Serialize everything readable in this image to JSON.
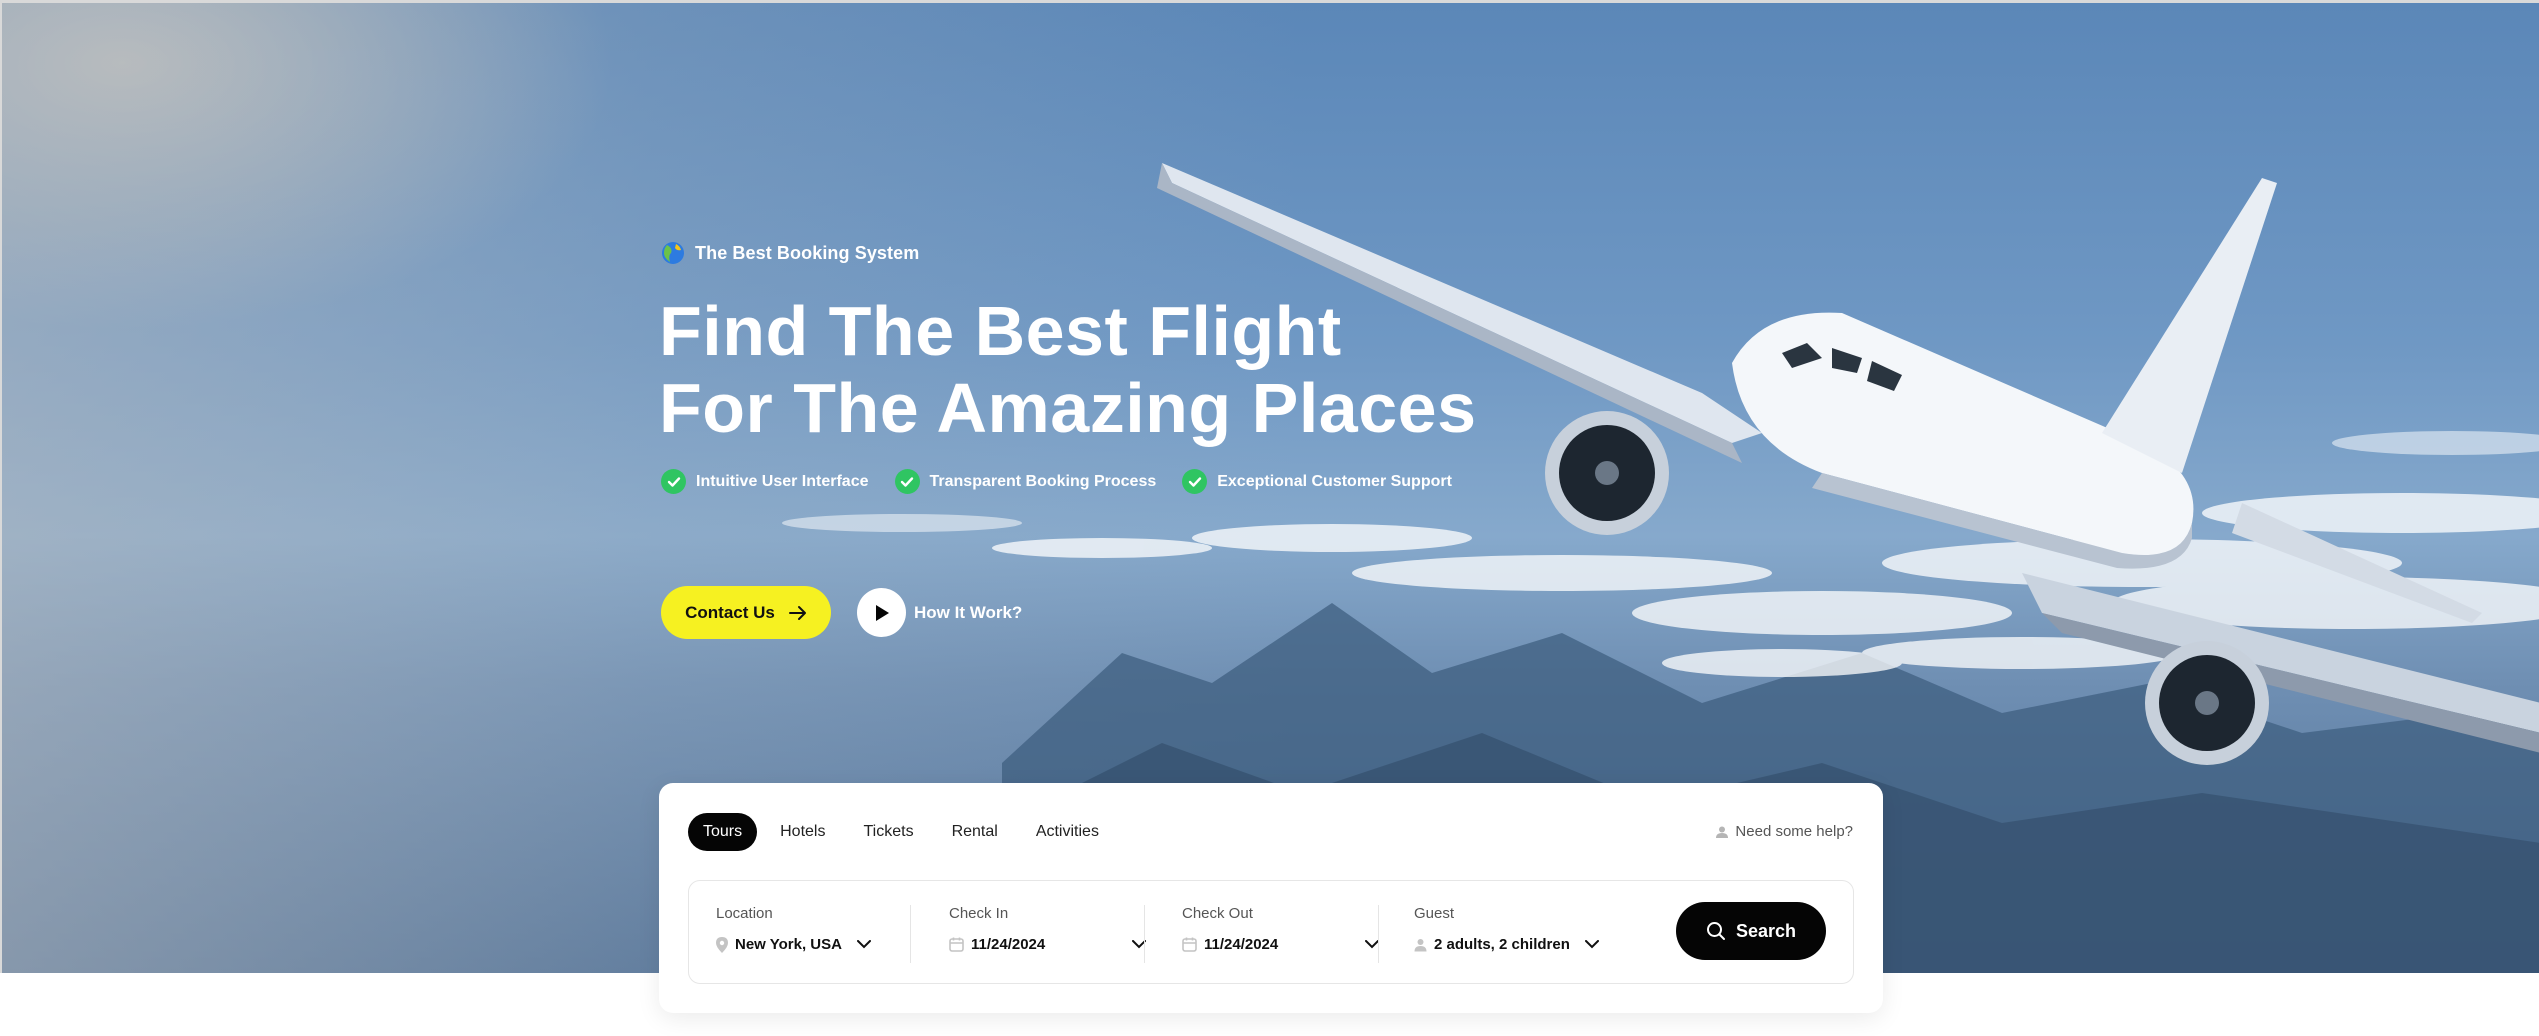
{
  "hero": {
    "badge": "The Best Booking System",
    "headline_line1": "Find The Best Flight",
    "headline_line2": "For The Amazing Places",
    "features": [
      "Intuitive User Interface",
      "Transparent Booking Process",
      "Exceptional Customer Support"
    ],
    "contact_button": "Contact Us",
    "how_it_works": "How It Work?"
  },
  "search": {
    "tabs": [
      "Tours",
      "Hotels",
      "Tickets",
      "Rental",
      "Activities"
    ],
    "active_tab": "Tours",
    "help": "Need some help?",
    "location": {
      "label": "Location",
      "value": "New York, USA"
    },
    "check_in": {
      "label": "Check In",
      "value": "11/24/2024"
    },
    "check_out": {
      "label": "Check Out",
      "value": "11/24/2024"
    },
    "guest": {
      "label": "Guest",
      "value": "2 adults, 2 children"
    },
    "search_button": "Search"
  },
  "colors": {
    "accent_yellow": "#f6f121",
    "check_green": "#2fc562",
    "dark": "#050505"
  }
}
